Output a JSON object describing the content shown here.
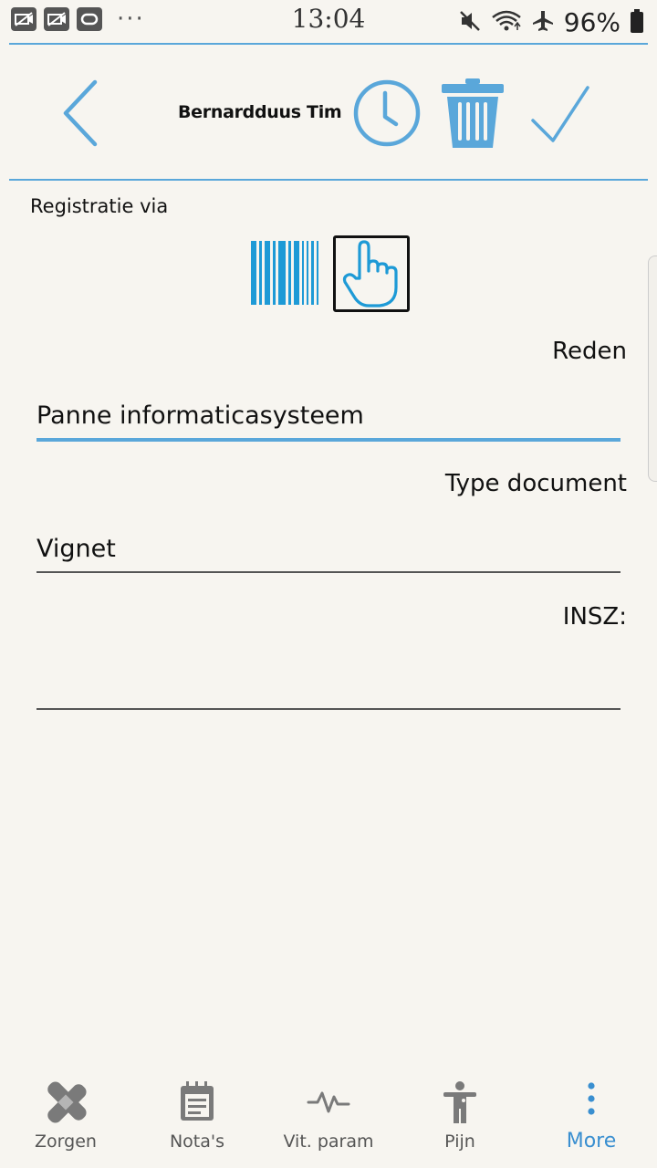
{
  "status_bar": {
    "time": "13:04",
    "battery": "96%",
    "more_dots": "···",
    "icons": [
      "no-photo-icon",
      "no-video-icon",
      "voicemail-icon",
      "mute-icon",
      "wifi-icon",
      "airplane-icon",
      "battery-icon"
    ]
  },
  "header": {
    "patient_name": "Bernardduus Tim",
    "icons": [
      "back-chevron-icon",
      "clock-icon",
      "trash-icon",
      "check-icon"
    ],
    "accent_color": "#5aa7da"
  },
  "form": {
    "registration_label": "Registratie via",
    "registration_options": [
      "barcode-icon",
      "hand-pointer-icon"
    ],
    "selected_option": "hand-pointer-icon",
    "fields": [
      {
        "label": "Reden",
        "value": "Panne informaticasysteem",
        "active": true
      },
      {
        "label": "Type document",
        "value": "Vignet",
        "active": false
      },
      {
        "label": "INSZ:",
        "value": "",
        "active": false
      }
    ]
  },
  "bottom_nav": {
    "items": [
      {
        "label": "Zorgen",
        "icon": "bandage-icon",
        "active": false
      },
      {
        "label": "Nota's",
        "icon": "notepad-icon",
        "active": false
      },
      {
        "label": "Vit. param",
        "icon": "pulse-icon",
        "active": false
      },
      {
        "label": "Pijn",
        "icon": "body-icon",
        "active": false
      },
      {
        "label": "More",
        "icon": "more-vertical-icon",
        "active": true
      }
    ],
    "active_color": "#3a8fd0"
  }
}
